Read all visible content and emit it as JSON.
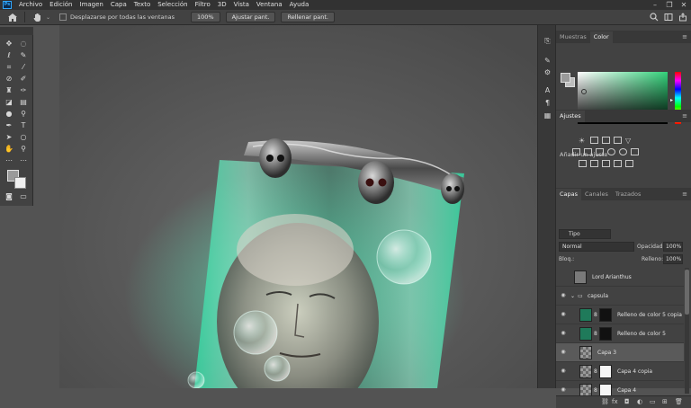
{
  "menubar": {
    "logo": "Ps",
    "items": [
      "Archivo",
      "Edición",
      "Imagen",
      "Capa",
      "Texto",
      "Selección",
      "Filtro",
      "3D",
      "Vista",
      "Ventana",
      "Ayuda"
    ]
  },
  "options": {
    "scroll_all_label": "Desplazarse por todas las ventanas",
    "zoom_100": "100%",
    "fit_screen": "Ajustar pant.",
    "fill_screen": "Rellenar pant."
  },
  "panels": {
    "color_tabs": [
      "Muestras",
      "Color"
    ],
    "adjust_tab": "Ajustes",
    "adjust_hint": "Añadir un ajuste",
    "layer_tabs": [
      "Capas",
      "Canales",
      "Trazados"
    ],
    "filter_label": "Tipo",
    "blend_mode": "Normal",
    "opacity_label": "Opacidad:",
    "opacity_value": "100%",
    "lock_label": "Bloq.:",
    "fill_label": "Relleno:",
    "fill_value": "100%"
  },
  "layers": [
    {
      "name": "Lord Arianthus",
      "visible": false,
      "selected": false,
      "indent": 0,
      "kind": "image"
    },
    {
      "name": "capsula",
      "visible": true,
      "selected": false,
      "indent": 0,
      "kind": "group"
    },
    {
      "name": "Relleno de color 5 copia",
      "visible": true,
      "selected": false,
      "indent": 1,
      "kind": "fill"
    },
    {
      "name": "Relleno de color 5",
      "visible": true,
      "selected": false,
      "indent": 1,
      "kind": "fill"
    },
    {
      "name": "Capa 3",
      "visible": true,
      "selected": true,
      "indent": 1,
      "kind": "pixel"
    },
    {
      "name": "Capa 4 copia",
      "visible": true,
      "selected": false,
      "indent": 1,
      "kind": "masked"
    },
    {
      "name": "Capa 4",
      "visible": true,
      "selected": false,
      "indent": 1,
      "kind": "masked"
    }
  ],
  "colors": {
    "foreground": "#9a9a9a",
    "background": "#f0f0f0",
    "capsule_glow": "#4fe3b0",
    "fill_layer": "#1f7a5a"
  }
}
